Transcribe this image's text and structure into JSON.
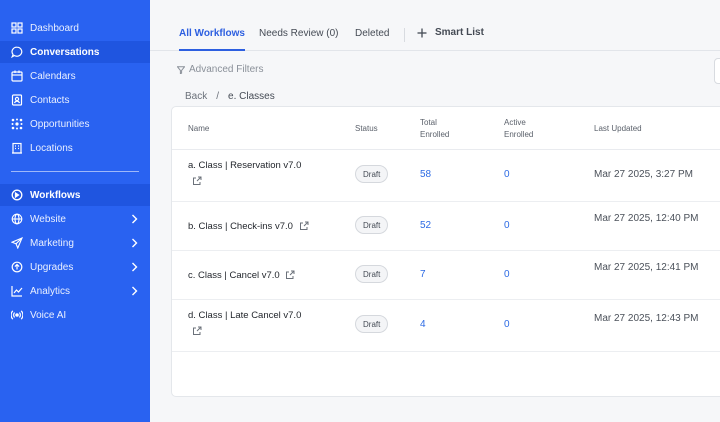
{
  "sidebar": {
    "items": [
      {
        "label": "Dashboard",
        "icon": "dashboard-icon"
      },
      {
        "label": "Conversations",
        "icon": "chat-icon"
      },
      {
        "label": "Calendars",
        "icon": "calendar-icon"
      },
      {
        "label": "Contacts",
        "icon": "contacts-icon"
      },
      {
        "label": "Opportunities",
        "icon": "opportunities-icon"
      },
      {
        "label": "Locations",
        "icon": "building-icon"
      },
      {
        "label": "Workflows",
        "icon": "workflow-icon"
      },
      {
        "label": "Website",
        "icon": "globe-icon"
      },
      {
        "label": "Marketing",
        "icon": "send-icon"
      },
      {
        "label": "Upgrades",
        "icon": "upgrade-icon"
      },
      {
        "label": "Analytics",
        "icon": "chart-icon"
      },
      {
        "label": "Voice AI",
        "icon": "voice-icon"
      }
    ]
  },
  "tabs": {
    "all": "All Workflows",
    "review": "Needs Review (0)",
    "deleted": "Deleted",
    "smart_list": "Smart List"
  },
  "filters": {
    "label": "Advanced Filters"
  },
  "breadcrumb": {
    "back": "Back",
    "sep": "/",
    "current": "e. Classes"
  },
  "table": {
    "headers": {
      "name": "Name",
      "status": "Status",
      "total_1": "Total",
      "total_2": "Enrolled",
      "active_1": "Active",
      "active_2": "Enrolled",
      "updated": "Last Updated"
    },
    "rows": [
      {
        "name": "a. Class | Reservation v7.0",
        "status": "Draft",
        "total": "58",
        "active": "0",
        "updated": "Mar 27 2025, 3:27 PM"
      },
      {
        "name": "b. Class | Check-ins v7.0",
        "status": "Draft",
        "total": "52",
        "active": "0",
        "updated": "Mar 27 2025, 12:40 PM"
      },
      {
        "name": "c. Class | Cancel v7.0",
        "status": "Draft",
        "total": "7",
        "active": "0",
        "updated": "Mar 27 2025, 12:41 PM"
      },
      {
        "name": "d. Class | Late Cancel v7.0",
        "status": "Draft",
        "total": "4",
        "active": "0",
        "updated": "Mar 27 2025, 12:43 PM"
      }
    ]
  },
  "colors": {
    "sidebar_bg": "#2962f1",
    "accent": "#2d5fe0",
    "link": "#2d6be4"
  }
}
